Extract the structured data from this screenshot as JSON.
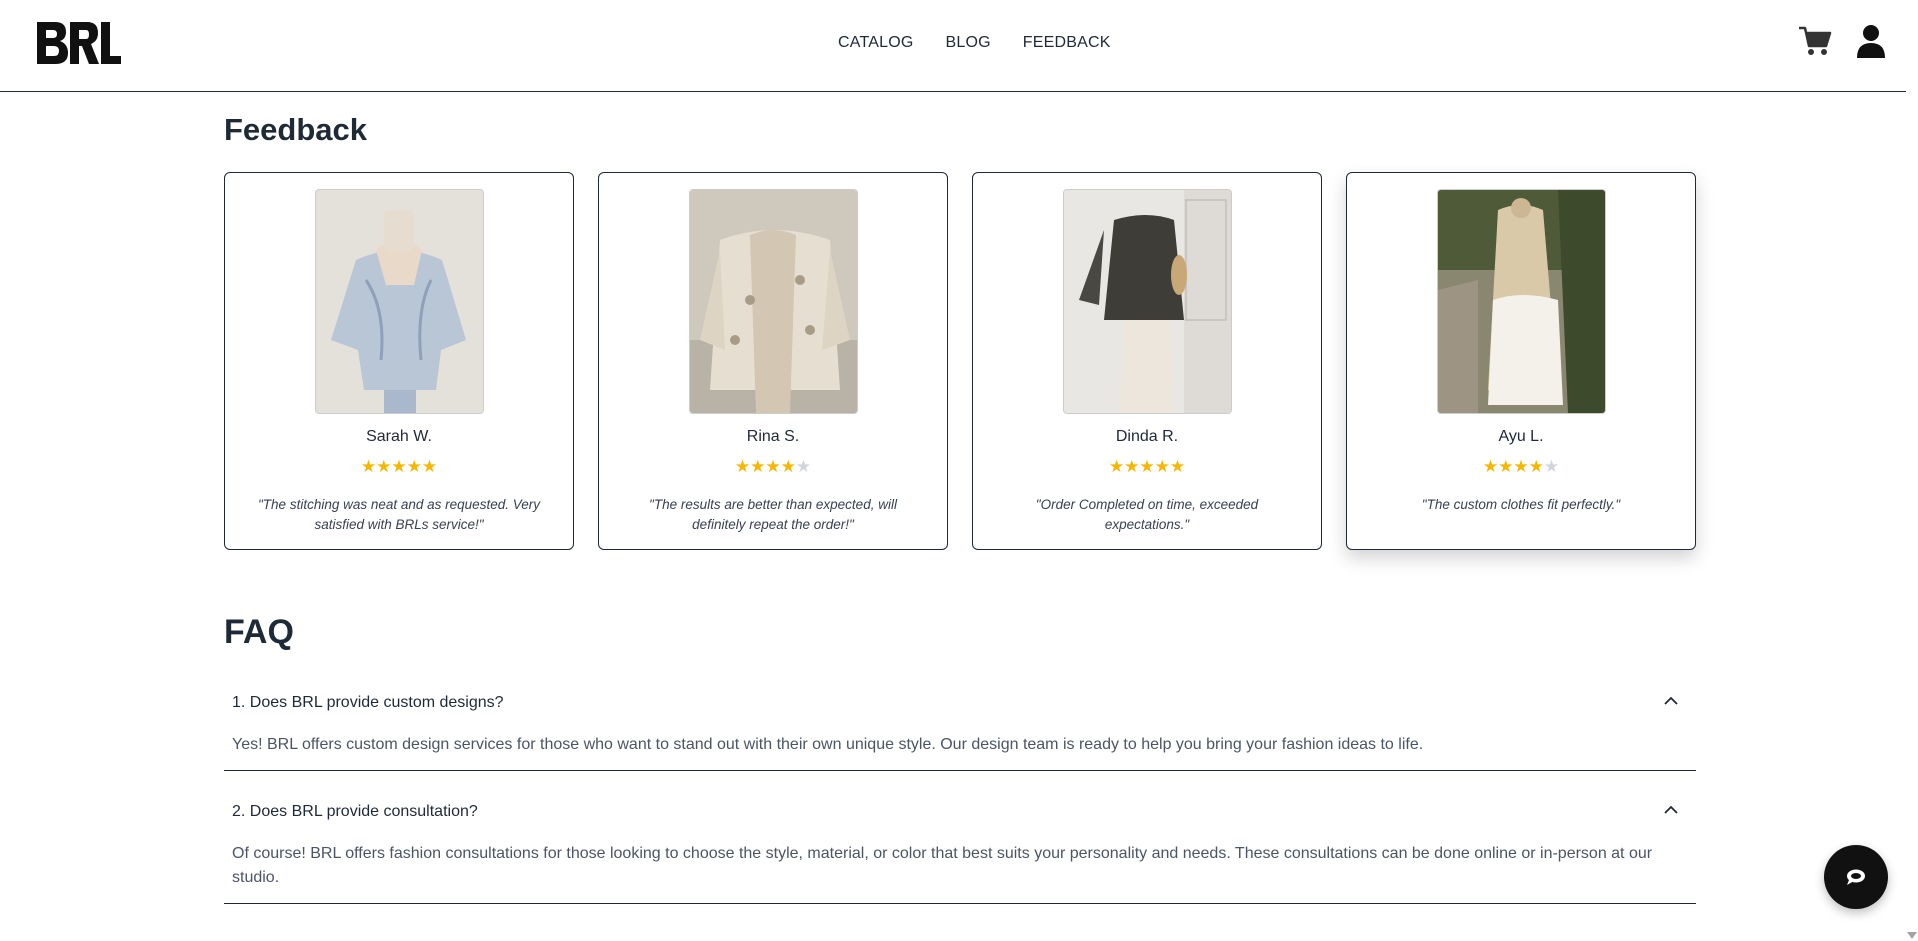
{
  "header": {
    "logo_text": "BRL",
    "nav": [
      {
        "label": "CATALOG"
      },
      {
        "label": "BLOG"
      },
      {
        "label": "FEEDBACK"
      }
    ],
    "icons": [
      "cart-icon",
      "user-icon"
    ]
  },
  "feedback": {
    "title": "Feedback",
    "cards": [
      {
        "name": "Sarah W.",
        "rating": 5,
        "quote": "\"The stitching was neat and as requested. Very satisfied with BRLs service!\""
      },
      {
        "name": "Rina S.",
        "rating": 4,
        "quote": "\"The results are better than expected, will definitely repeat the order!\""
      },
      {
        "name": "Dinda R.",
        "rating": 5,
        "quote": "\"Order Completed on time, exceeded expectations.\""
      },
      {
        "name": "Ayu L.",
        "rating": 4,
        "quote": "\"The custom clothes fit perfectly.\""
      }
    ]
  },
  "faq": {
    "title": "FAQ",
    "items": [
      {
        "question": "1. Does BRL provide custom designs?",
        "answer": "Yes! BRL offers custom design services for those who want to stand out with their own unique style. Our design team is ready to help you bring your fashion ideas to life."
      },
      {
        "question": "2. Does BRL provide consultation?",
        "answer": "Of course! BRL offers fashion consultations for those looking to choose the style, material, or color that best suits your personality and needs. These consultations can be done online or in-person at our studio."
      }
    ]
  },
  "colors": {
    "star": "#f5b800",
    "star_empty": "#d1d5db",
    "text": "#1f2937"
  }
}
